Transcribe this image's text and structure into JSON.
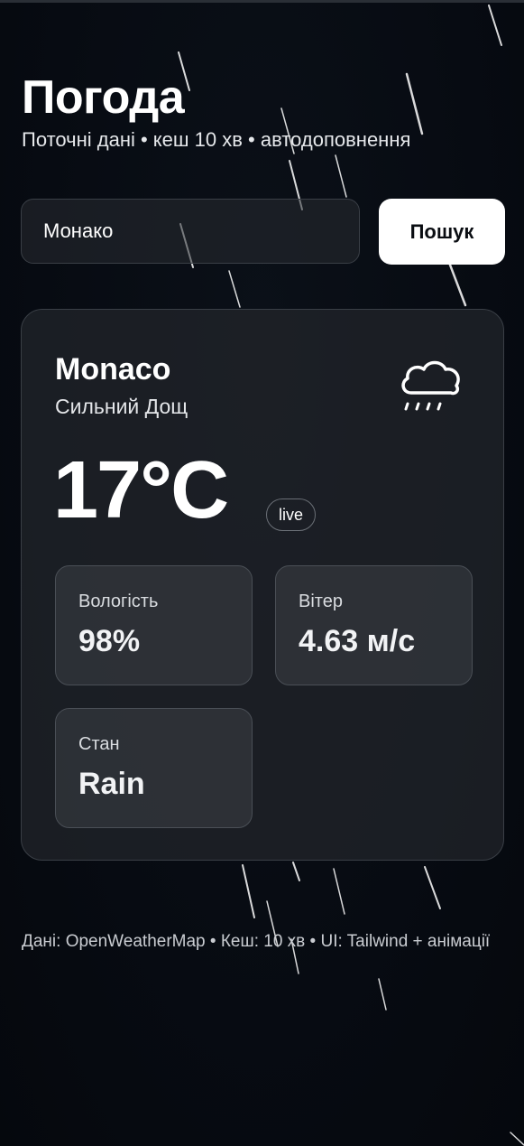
{
  "app": {
    "title": "Погода",
    "subtitle": "Поточні дані • кеш 10 хв • автодоповнення"
  },
  "search": {
    "value": "Монако",
    "placeholder": "",
    "button_label": "Пошук"
  },
  "weather": {
    "city": "Monaco",
    "condition": "Сильний Дощ",
    "icon": "cloud-rain-icon",
    "temperature": "17°C",
    "live_label": "live",
    "stats": [
      {
        "label": "Вологість",
        "value": "98%"
      },
      {
        "label": "Вітер",
        "value": "4.63 м/с"
      },
      {
        "label": "Стан",
        "value": "Rain"
      }
    ]
  },
  "footer": {
    "text": "Дані: OpenWeatherMap • Кеш: 10 хв • UI: Tailwind + анімації"
  },
  "colors": {
    "background": "#070b12",
    "card": "#22262b",
    "button": "#ffffff",
    "text": "#ffffff",
    "muted": "#c9ccd1"
  }
}
